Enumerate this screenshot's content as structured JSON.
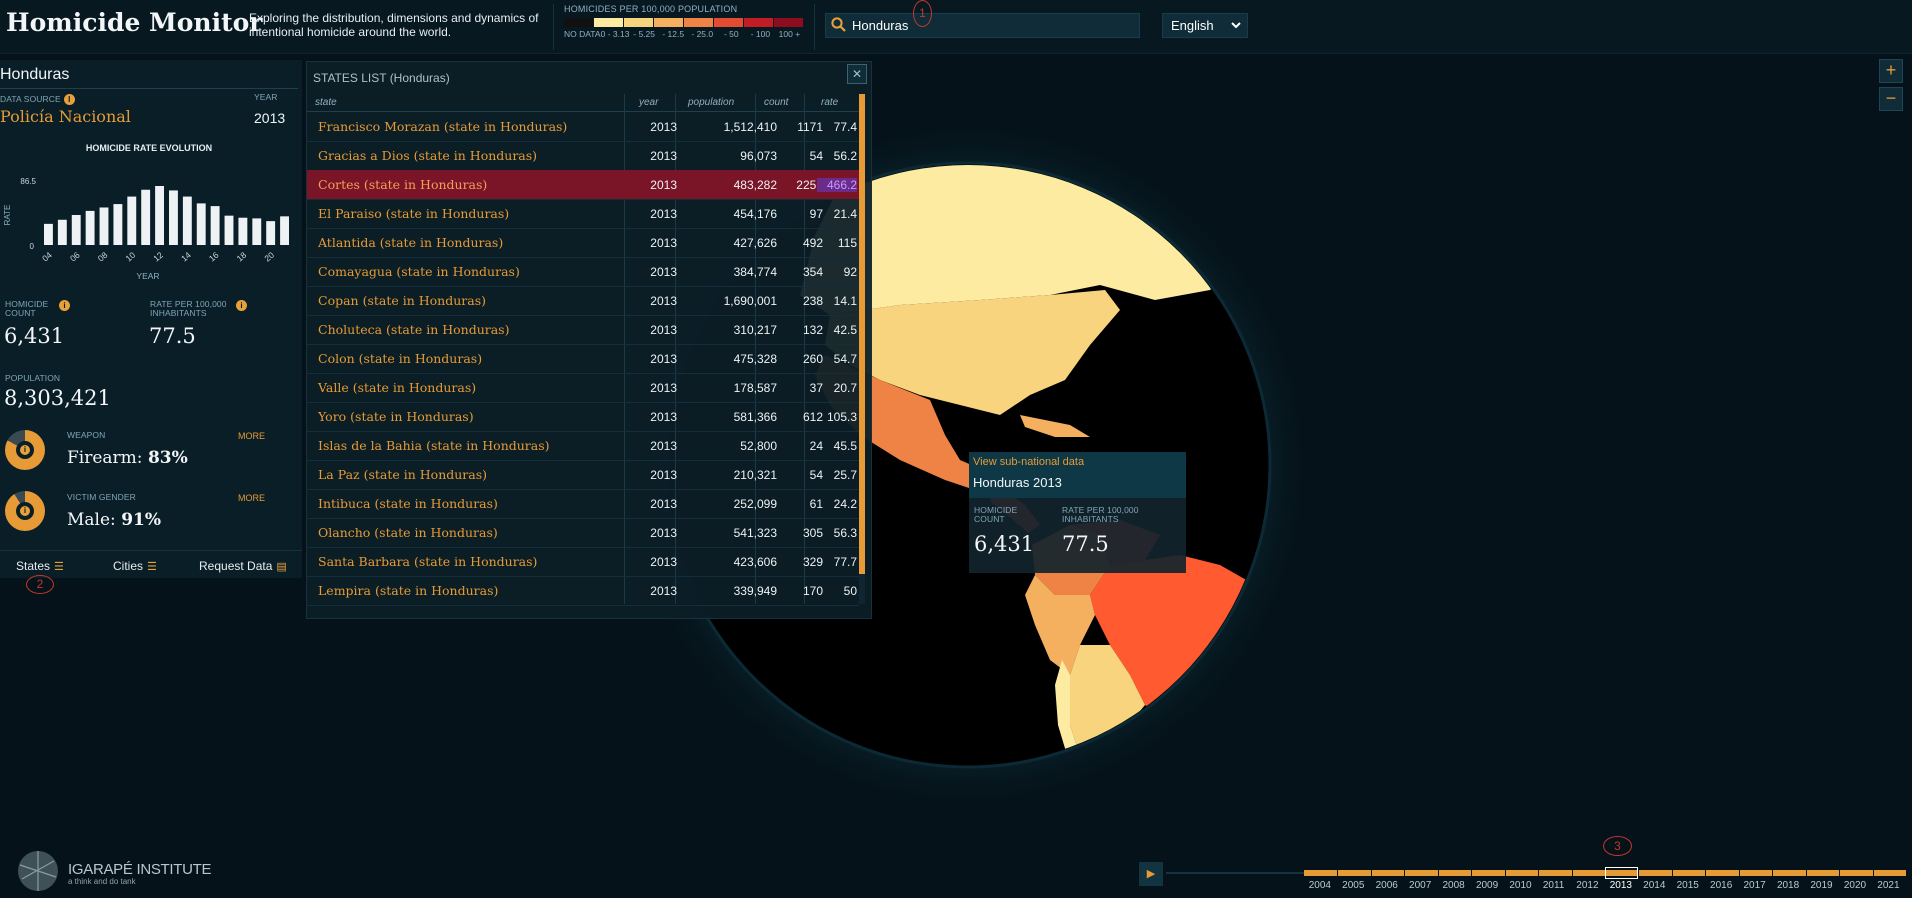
{
  "header": {
    "title": "Homicide Monitor",
    "tagline": "Exploring the distribution, dimensions and dynamics of intentional homicide around the world.",
    "legend": {
      "title": "HOMICIDES PER 100,000 POPULATION",
      "labels": [
        "NO DATA",
        "0 - 3.13",
        "- 5.25",
        "- 12.5",
        "- 25.0",
        "- 50",
        "- 100",
        "100 +"
      ],
      "colors": [
        "#111111",
        "#fdeca0",
        "#f9d47e",
        "#f4b05e",
        "#ee8345",
        "#e44c32",
        "#c21c25",
        "#8d0d1f"
      ]
    },
    "search": {
      "value": "Honduras",
      "icon": "search-icon"
    },
    "language": "English"
  },
  "annotations": {
    "a1": "1",
    "a2": "2",
    "a3": "3"
  },
  "left_panel": {
    "country": "Honduras",
    "data_source_label": "DATA SOURCE",
    "data_source": "Policía Nacional",
    "year_label": "YEAR",
    "year": "2013",
    "chart_title": "HOMICIDE RATE EVOLUTION",
    "homicide_count_label": "HOMICIDE COUNT",
    "homicide_count": "6,431",
    "rate_label": "RATE PER 100,000 INHABITANTS",
    "rate": "77.5",
    "population_label": "POPULATION",
    "population": "8,303,421",
    "weapon_label": "WEAPON",
    "weapon_name": "Firearm:",
    "weapon_pct": "83%",
    "gender_label": "VICTIM GENDER",
    "gender_name": "Male:",
    "gender_pct": "91%",
    "more": "MORE",
    "footer": {
      "states": "States",
      "cities": "Cities",
      "request": "Request Data"
    }
  },
  "chart_data": {
    "type": "bar",
    "title": "HOMICIDE RATE EVOLUTION",
    "xlabel": "YEAR",
    "ylabel": "RATE",
    "ylim": [
      0,
      86.5
    ],
    "y_ticks": [
      "0",
      "86.5"
    ],
    "x_ticks": [
      "04",
      "06",
      "08",
      "10",
      "12",
      "14",
      "16",
      "18",
      "20"
    ],
    "categories": [
      "2004",
      "2005",
      "2006",
      "2007",
      "2008",
      "2009",
      "2010",
      "2011",
      "2012",
      "2013",
      "2014",
      "2015",
      "2016",
      "2017",
      "2018",
      "2019",
      "2020",
      "2021"
    ],
    "values": [
      31,
      37,
      44,
      50,
      55,
      60,
      71,
      81,
      86.5,
      80,
      71,
      61,
      57,
      43,
      40,
      39,
      35,
      42
    ]
  },
  "states": {
    "title": "STATES LIST (Honduras)",
    "columns": [
      "state",
      "year",
      "population",
      "count",
      "rate"
    ],
    "highlight_index": 2,
    "rows": [
      {
        "state": "Francisco Morazan (state in Honduras)",
        "year": "2013",
        "population": "1,512,410",
        "count": "1171",
        "rate": "77.4"
      },
      {
        "state": "Gracias a Dios (state in Honduras)",
        "year": "2013",
        "population": "96,073",
        "count": "54",
        "rate": "56.2"
      },
      {
        "state": "Cortes (state in Honduras)",
        "year": "2013",
        "population": "483,282",
        "count": "2253",
        "rate": "466.2"
      },
      {
        "state": "El Paraiso (state in Honduras)",
        "year": "2013",
        "population": "454,176",
        "count": "97",
        "rate": "21.4"
      },
      {
        "state": "Atlantida (state in Honduras)",
        "year": "2013",
        "population": "427,626",
        "count": "492",
        "rate": "115"
      },
      {
        "state": "Comayagua (state in Honduras)",
        "year": "2013",
        "population": "384,774",
        "count": "354",
        "rate": "92"
      },
      {
        "state": "Copan (state in Honduras)",
        "year": "2013",
        "population": "1,690,001",
        "count": "238",
        "rate": "14.1"
      },
      {
        "state": "Choluteca (state in Honduras)",
        "year": "2013",
        "population": "310,217",
        "count": "132",
        "rate": "42.5"
      },
      {
        "state": "Colon (state in Honduras)",
        "year": "2013",
        "population": "475,328",
        "count": "260",
        "rate": "54.7"
      },
      {
        "state": "Valle (state in Honduras)",
        "year": "2013",
        "population": "178,587",
        "count": "37",
        "rate": "20.7"
      },
      {
        "state": "Yoro (state in Honduras)",
        "year": "2013",
        "population": "581,366",
        "count": "612",
        "rate": "105.3"
      },
      {
        "state": "Islas de la Bahia (state in Honduras)",
        "year": "2013",
        "population": "52,800",
        "count": "24",
        "rate": "45.5"
      },
      {
        "state": "La Paz (state in Honduras)",
        "year": "2013",
        "population": "210,321",
        "count": "54",
        "rate": "25.7"
      },
      {
        "state": "Intibuca (state in Honduras)",
        "year": "2013",
        "population": "252,099",
        "count": "61",
        "rate": "24.2"
      },
      {
        "state": "Olancho (state in Honduras)",
        "year": "2013",
        "population": "541,323",
        "count": "305",
        "rate": "56.3"
      },
      {
        "state": "Santa Barbara (state in Honduras)",
        "year": "2013",
        "population": "423,606",
        "count": "329",
        "rate": "77.7"
      },
      {
        "state": "Lempira (state in Honduras)",
        "year": "2013",
        "population": "339,949",
        "count": "170",
        "rate": "50"
      }
    ]
  },
  "tooltip": {
    "link": "View sub-national data",
    "title": "Honduras 2013",
    "count_label": "HOMICIDE COUNT",
    "count": "6,431",
    "rate_label": "RATE PER 100,000 INHABITANTS",
    "rate": "77.5"
  },
  "zoom": {
    "in": "+",
    "out": "−"
  },
  "timeline": {
    "years": [
      "2004",
      "2005",
      "2006",
      "2007",
      "2008",
      "2009",
      "2010",
      "2011",
      "2012",
      "2013",
      "2014",
      "2015",
      "2016",
      "2017",
      "2018",
      "2019",
      "2020",
      "2021"
    ],
    "selected": "2013"
  },
  "logo": {
    "name": "IGARAPÉ INSTITUTE",
    "tagline": "a think and do tank"
  }
}
